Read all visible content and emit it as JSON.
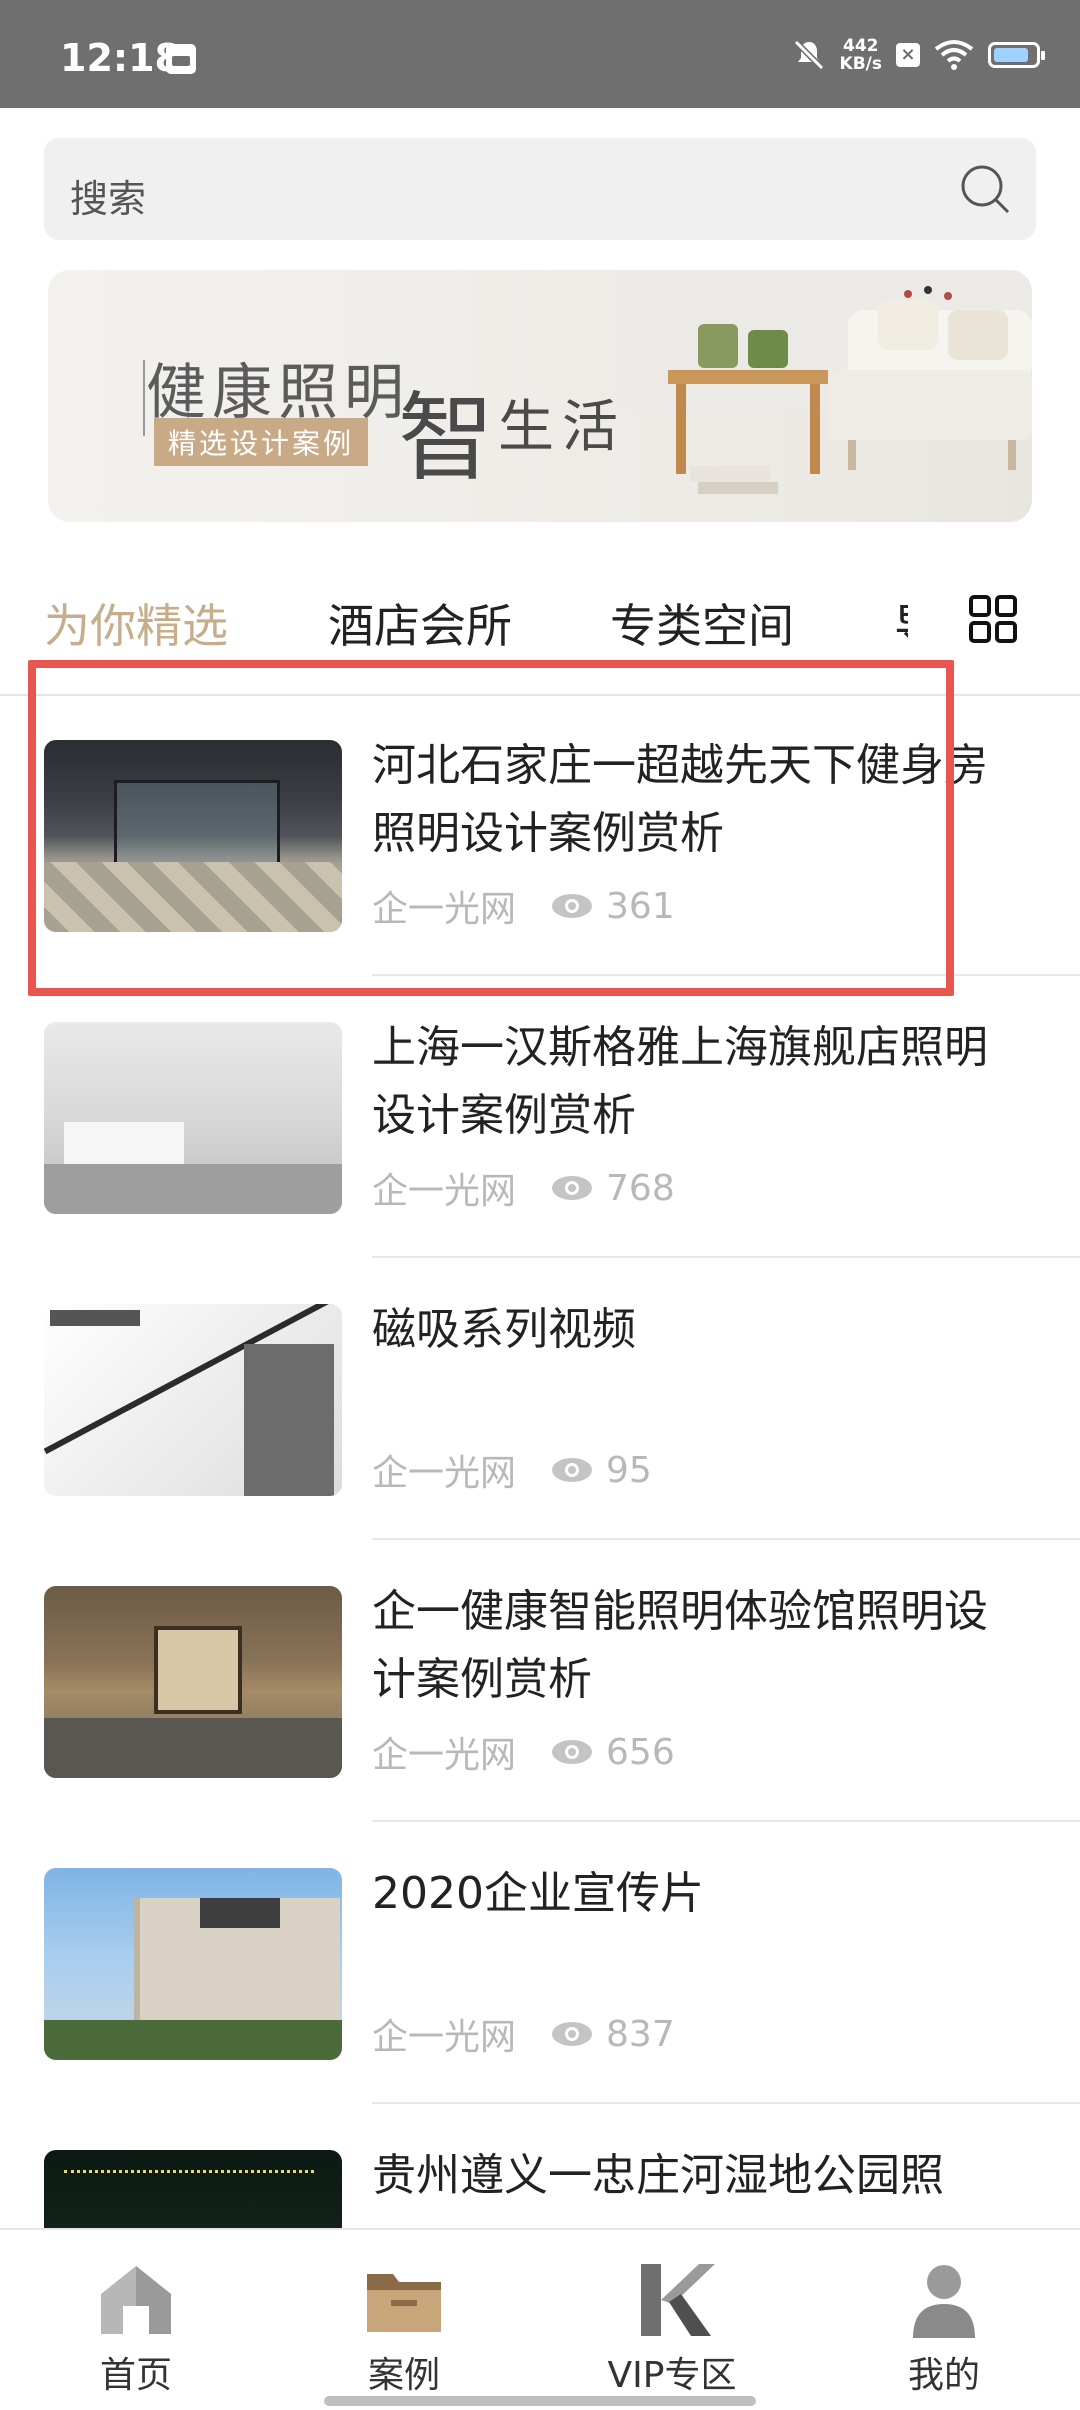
{
  "status_bar": {
    "time": "12:18",
    "net_speed_value": "442",
    "net_speed_unit": "KB/s",
    "icons": [
      "calendar-icon",
      "mute-icon",
      "network-speed",
      "sim-icon",
      "wifi-icon",
      "battery-icon"
    ]
  },
  "search": {
    "placeholder": "搜索",
    "icon": "search-icon"
  },
  "banner": {
    "title": "健康照明",
    "subtitle": "精选设计案例",
    "big_char": "智",
    "tail": "生活"
  },
  "tabs": {
    "items": [
      "为你精选",
      "酒店会所",
      "专类空间"
    ],
    "active_index": 0,
    "partial_tab": "导",
    "accent_color": "#c6ad8b",
    "grid_icon": "grid-icon"
  },
  "articles": [
    {
      "title": "河北石家庄一超越先天下健身房照明设计案例赏析",
      "source": "企一光网",
      "views": "361"
    },
    {
      "title": "上海一汉斯格雅上海旗舰店照明设计案例赏析",
      "source": "企一光网",
      "views": "768"
    },
    {
      "title": "磁吸系列视频",
      "source": "企一光网",
      "views": "95"
    },
    {
      "title": "企一健康智能照明体验馆照明设计案例赏析",
      "source": "企一光网",
      "views": "656"
    },
    {
      "title": "2020企业宣传片",
      "source": "企一光网",
      "views": "837"
    },
    {
      "title": "贵州遵义一忠庄河湿地公园照",
      "source": "",
      "views": ""
    }
  ],
  "highlight_color": "#e9564f",
  "bottom_nav": [
    {
      "label": "首页",
      "icon": "home-icon"
    },
    {
      "label": "案例",
      "icon": "folder-icon"
    },
    {
      "label": "VIP专区",
      "icon": "vip-k-icon"
    },
    {
      "label": "我的",
      "icon": "user-icon"
    }
  ]
}
